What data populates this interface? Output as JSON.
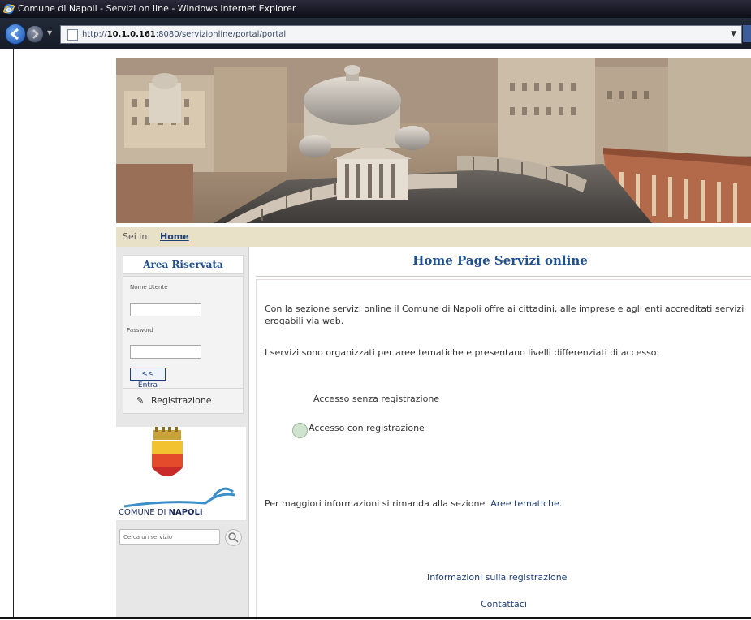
{
  "window": {
    "title": "Comune di Napoli - Servizi on line - Windows Internet Explorer"
  },
  "address_bar": {
    "url_prefix": "http://",
    "url_host": "10.1.0.161",
    "url_rest": ":8080/servizionline/portal/portal"
  },
  "breadcrumb": {
    "label": "Sei in:",
    "link": "Home"
  },
  "sidebar": {
    "heading": "Area Riservata",
    "username_label": "Nome Utente",
    "password_label": "Password",
    "login_button": "<< Entra",
    "register_label": "Registrazione",
    "logo_text_left": "COMUNE DI ",
    "logo_text_bold": "NAPOLI",
    "search_placeholder": "Cerca un servizio"
  },
  "main": {
    "title": "Home Page Servizi online",
    "intro": "Con la sezione servizi online il Comune di Napoli offre ai cittadini, alle imprese e agli enti accreditati servizi erogabili via web.",
    "organized": "I servizi sono organizzati per aree tematiche e presentano livelli differenziati di accesso:",
    "access_without": "Accesso senza registrazione",
    "access_with": "Accesso con registrazione",
    "more_info_prefix": "Per maggiori informazioni si rimanda alla sezione",
    "more_info_link": "Aree tematiche.",
    "link_registration_info": "Informazioni sulla registrazione",
    "link_contact": "Contattaci"
  },
  "colors": {
    "accent": "#1f4f8f",
    "breadcrumb_bg": "#e9e0c8",
    "sidebar_bg": "#e7e7e7"
  },
  "icons": [
    "ie-icon",
    "back-icon",
    "forward-icon",
    "page-icon",
    "pencil-icon",
    "access-icon",
    "search-icon",
    "coat-of-arms-icon"
  ]
}
